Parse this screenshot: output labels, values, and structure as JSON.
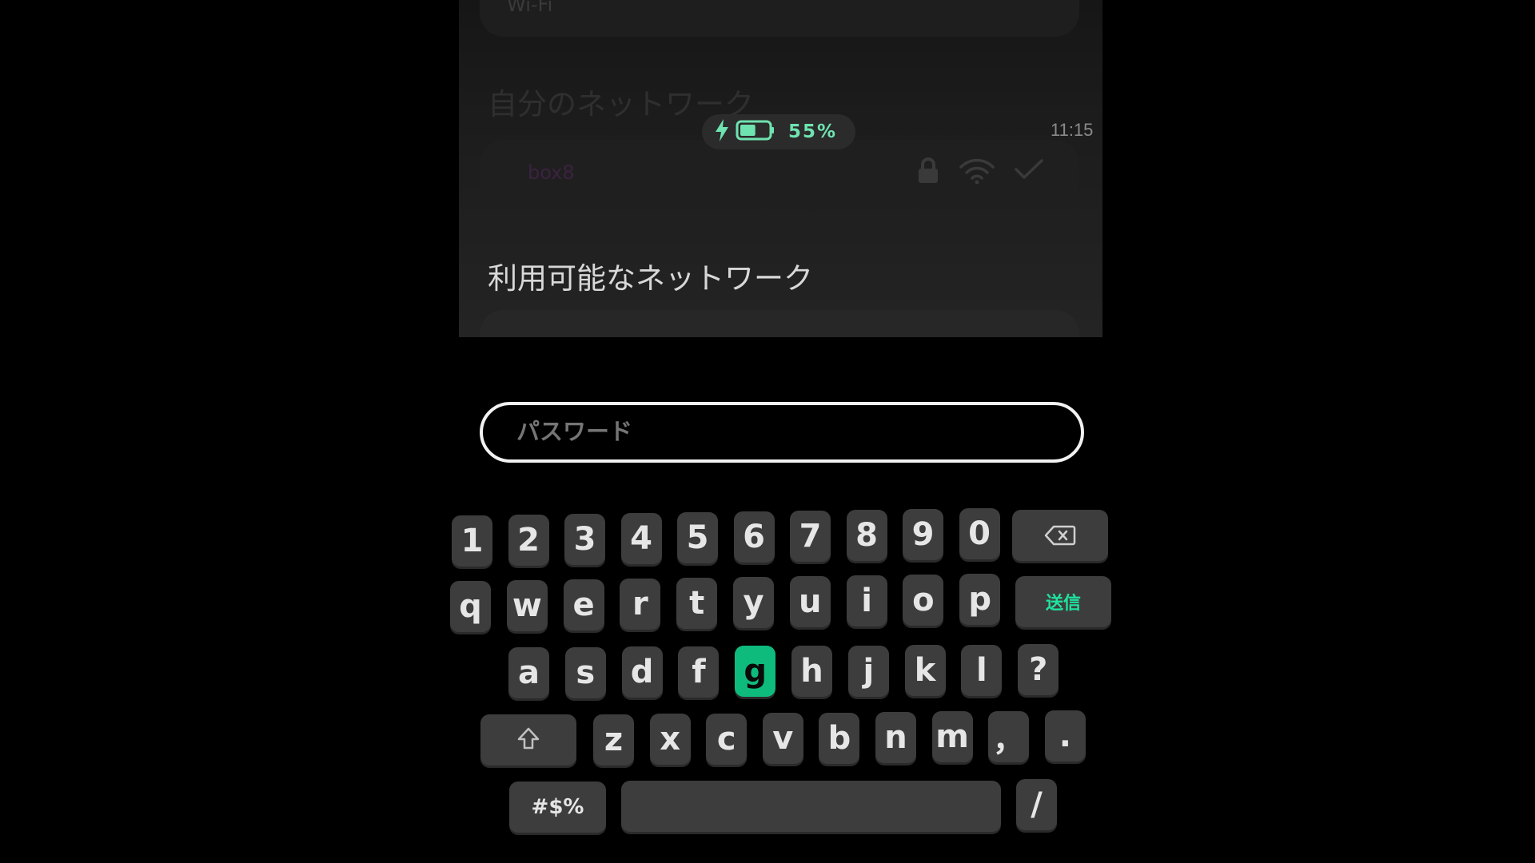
{
  "settings": {
    "wifi_label": "Wi-Fi",
    "my_networks_title": "自分のネットワーク",
    "my_network_name": "box8",
    "available_networks_title": "利用可能なネットワーク"
  },
  "status": {
    "battery_percent": "55%",
    "battery_level": 0.55,
    "charging": true,
    "time": "11:15"
  },
  "password": {
    "placeholder": "パスワード",
    "value": ""
  },
  "keyboard": {
    "numbers": [
      "1",
      "2",
      "3",
      "4",
      "5",
      "6",
      "7",
      "8",
      "9",
      "0"
    ],
    "row_q": [
      "q",
      "w",
      "e",
      "r",
      "t",
      "y",
      "u",
      "i",
      "o",
      "p"
    ],
    "row_a": [
      "a",
      "s",
      "d",
      "f",
      "g",
      "h",
      "j",
      "k",
      "l",
      "?"
    ],
    "row_z": [
      "z",
      "x",
      "c",
      "v",
      "b",
      "n",
      "m",
      "，",
      "."
    ],
    "send_label": "送信",
    "symbols_label": "#$%",
    "slash_label": "/",
    "highlighted_key": "g"
  },
  "colors": {
    "accent": "#0fbb7c",
    "send_text": "#1fe39e",
    "battery": "#6fe3b0",
    "key_bg": "#3d3d3d"
  },
  "icons": {
    "backspace": "backspace-icon",
    "shift": "shift-icon",
    "lock": "lock-icon",
    "wifi": "wifi-icon",
    "check": "check-icon",
    "charging": "lightning-icon",
    "battery": "battery-icon"
  }
}
